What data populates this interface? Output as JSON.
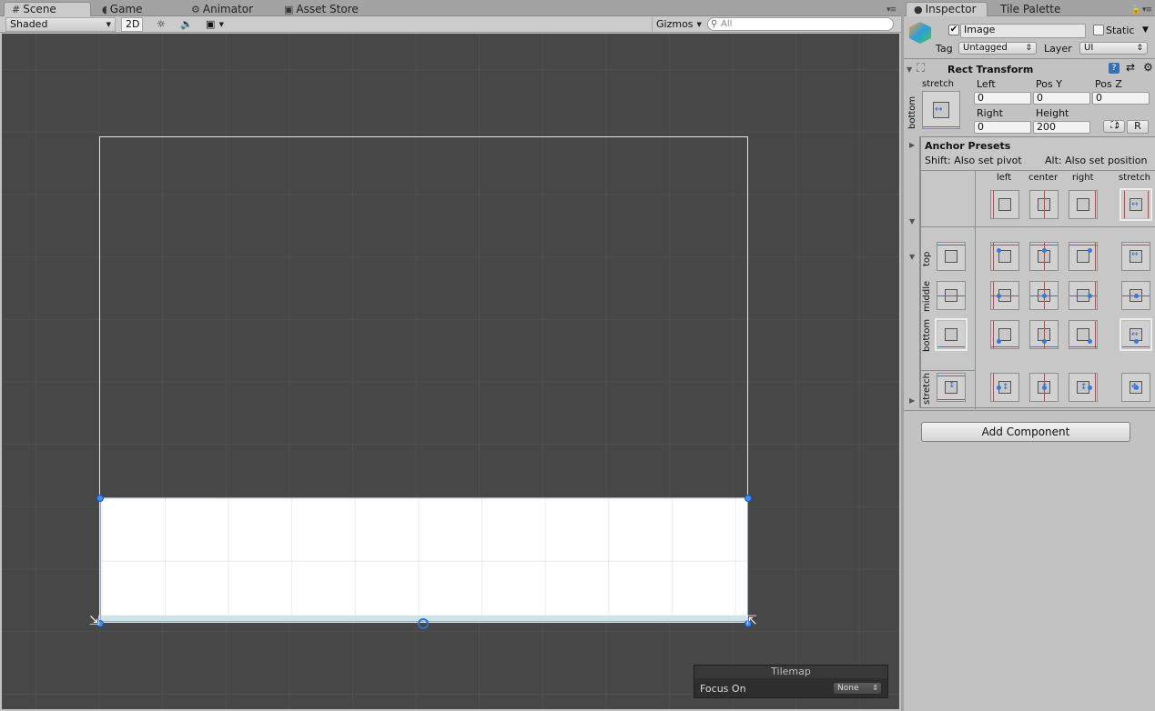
{
  "scene_tabs": [
    {
      "icon": "#",
      "label": "Scene"
    },
    {
      "icon": "◖",
      "label": "Game"
    },
    {
      "icon": "⚙",
      "label": "Animator"
    },
    {
      "icon": "▣",
      "label": "Asset Store"
    }
  ],
  "toolbar": {
    "shading_mode": "Shaded",
    "mode_2d": "2D",
    "gizmos": "Gizmos",
    "search_placeholder": "All"
  },
  "tilemap_overlay": {
    "title": "Tilemap",
    "focus_label": "Focus On",
    "focus_value": "None"
  },
  "inspector_tabs": [
    {
      "icon": "●",
      "label": "Inspector"
    },
    {
      "icon": "",
      "label": "Tile Palette"
    }
  ],
  "object": {
    "name": "Image",
    "active": "✔",
    "static_label": "Static",
    "tag_label": "Tag",
    "tag_value": "Untagged",
    "layer_label": "Layer",
    "layer_value": "UI"
  },
  "rect_transform": {
    "title": "Rect Transform",
    "anchor_label": "stretch",
    "side_label": "bottom",
    "left_label": "Left",
    "left_value": "0",
    "posy_label": "Pos Y",
    "posy_value": "0",
    "posz_label": "Pos Z",
    "posz_value": "0",
    "right_label": "Right",
    "right_value": "0",
    "height_label": "Height",
    "height_value": "200",
    "raw_button": "R"
  },
  "anchor_presets": {
    "title": "Anchor Presets",
    "shift_hint": "Shift: Also set pivot",
    "alt_hint": "Alt: Also set position",
    "col_labels": [
      "left",
      "center",
      "right",
      "stretch"
    ],
    "row_labels": [
      "top",
      "middle",
      "bottom",
      "stretch"
    ]
  },
  "add_component": "Add Component",
  "colors": {
    "viewport_bg": "#474747",
    "handle_blue": "#3c8dff",
    "anchor_red": "#d04040"
  }
}
